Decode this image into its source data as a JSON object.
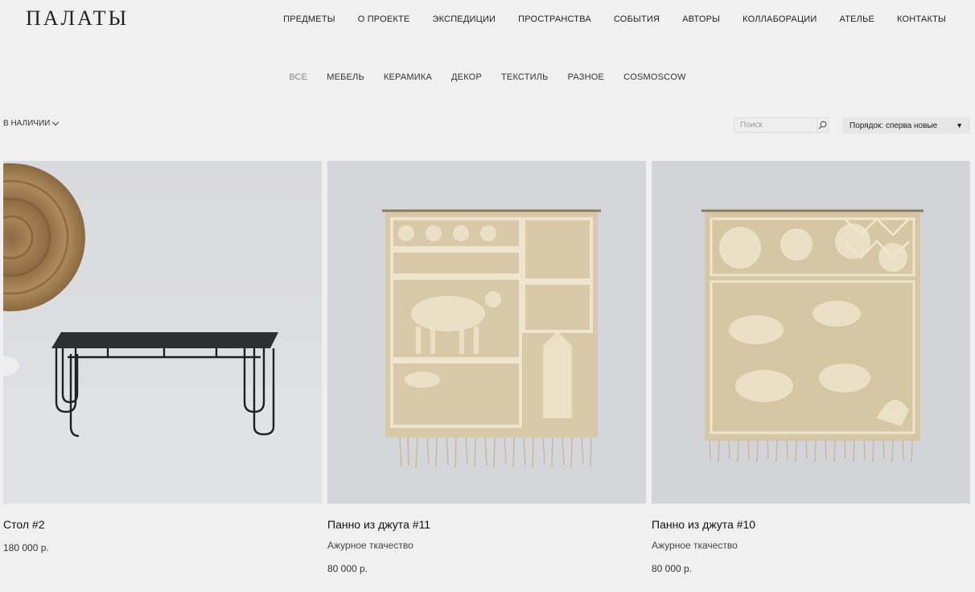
{
  "header": {
    "logo": "ПАЛАТЫ",
    "nav": [
      "ПРЕДМЕТЫ",
      "О ПРОЕКТЕ",
      "ЭКСПЕДИЦИИ",
      "ПРОСТРАНСТВА",
      "СОБЫТИЯ",
      "АВТОРЫ",
      "КОЛЛАБОРАЦИИ",
      "АТЕЛЬЕ",
      "КОНТАКТЫ"
    ]
  },
  "categories": {
    "items": [
      "ВСЕ",
      "МЕБЕЛЬ",
      "КЕРАМИКА",
      "ДЕКОР",
      "ТЕКСТИЛЬ",
      "РАЗНОЕ",
      "COSMOSCOW"
    ],
    "active": "ВСЕ"
  },
  "toolbar": {
    "filter_label": "В НАЛИЧИИ",
    "search_placeholder": "Поиск",
    "sort_value": "Порядок: сперва новые"
  },
  "products": [
    {
      "title": "Стол #2",
      "subtitle": "",
      "price": "180 000 р."
    },
    {
      "title": "Панно из джута #11",
      "subtitle": "Ажурное ткачество",
      "price": "80 000 р."
    },
    {
      "title": "Панно из джута #10",
      "subtitle": "Ажурное ткачество",
      "price": "80 000 р."
    }
  ],
  "colors": {
    "background": "#f0f0f0",
    "text": "#222222",
    "jute": "#d8c9a8"
  }
}
